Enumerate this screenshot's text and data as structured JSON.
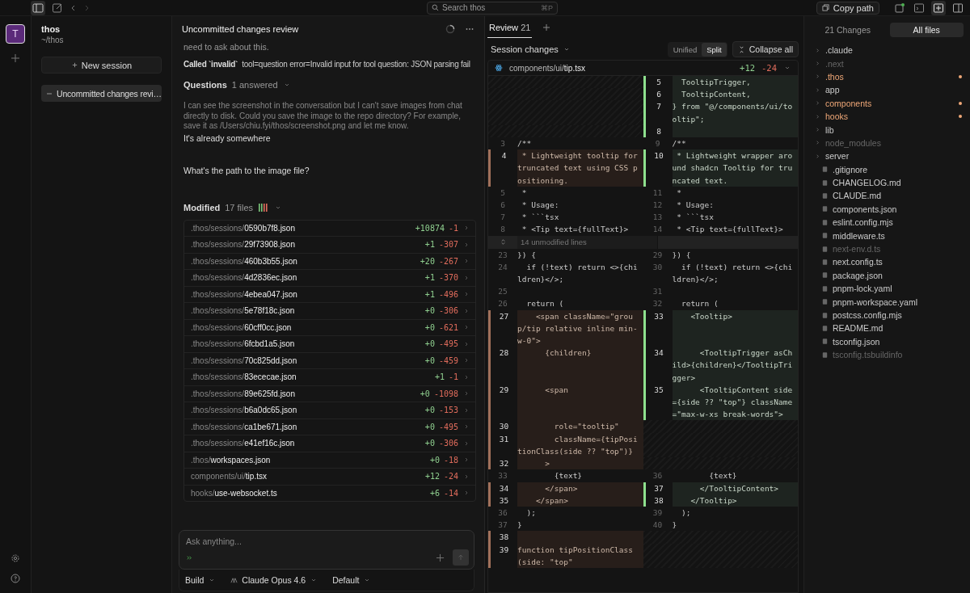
{
  "topbar": {
    "search": {
      "placeholder": "Search thos",
      "shortcut": "⌘P"
    },
    "copy_path": "Copy path"
  },
  "rail": {
    "avatar": "T"
  },
  "sidebar": {
    "project": "thos",
    "path": "~/thos",
    "new_session": "New session",
    "sessions": [
      {
        "title": "Uncommitted changes revi…",
        "selected": true
      }
    ]
  },
  "chat": {
    "title": "Uncommitted changes review",
    "cut_text": "need to ask about this.",
    "tool_call": {
      "label": "Called `invalid`",
      "detail": "tool=question  error=Invalid input for tool question: JSON parsing fail"
    },
    "questions": {
      "label": "Questions",
      "status": "1 answered"
    },
    "assistant_text": "I can see the screenshot in the conversation but I can't save images from chat directly to disk. Could you save the image to the repo directory? For example, save it as /Users/chiu.fyi/thos/screenshot.png and let me know.",
    "answer": "It's already somewhere",
    "question": "What's the path to the image file?",
    "modified": {
      "label": "Modified",
      "count": "17 files"
    },
    "files": [
      {
        "dir": ".thos/sessions/",
        "name": "0590b7f8.json",
        "added": "+10874",
        "removed": "-1"
      },
      {
        "dir": ".thos/sessions/",
        "name": "29f73908.json",
        "added": "+1",
        "removed": "-307"
      },
      {
        "dir": ".thos/sessions/",
        "name": "460b3b55.json",
        "added": "+20",
        "removed": "-267"
      },
      {
        "dir": ".thos/sessions/",
        "name": "4d2836ec.json",
        "added": "+1",
        "removed": "-370"
      },
      {
        "dir": ".thos/sessions/",
        "name": "4ebea047.json",
        "added": "+1",
        "removed": "-496"
      },
      {
        "dir": ".thos/sessions/",
        "name": "5e78f18c.json",
        "added": "+0",
        "removed": "-306"
      },
      {
        "dir": ".thos/sessions/",
        "name": "60cff0cc.json",
        "added": "+0",
        "removed": "-621"
      },
      {
        "dir": ".thos/sessions/",
        "name": "6fcbd1a5.json",
        "added": "+0",
        "removed": "-495"
      },
      {
        "dir": ".thos/sessions/",
        "name": "70c825dd.json",
        "added": "+0",
        "removed": "-459"
      },
      {
        "dir": ".thos/sessions/",
        "name": "83ececae.json",
        "added": "+1",
        "removed": "-1"
      },
      {
        "dir": ".thos/sessions/",
        "name": "89e625fd.json",
        "added": "+0",
        "removed": "-1098"
      },
      {
        "dir": ".thos/sessions/",
        "name": "b6a0dc65.json",
        "added": "+0",
        "removed": "-153"
      },
      {
        "dir": ".thos/sessions/",
        "name": "ca1be671.json",
        "added": "+0",
        "removed": "-495"
      },
      {
        "dir": ".thos/sessions/",
        "name": "e41ef16c.json",
        "added": "+0",
        "removed": "-306"
      },
      {
        "dir": ".thos/",
        "name": "workspaces.json",
        "added": "+0",
        "removed": "-18"
      },
      {
        "dir": "components/ui/",
        "name": "tip.tsx",
        "added": "+12",
        "removed": "-24"
      },
      {
        "dir": "hooks/",
        "name": "use-websocket.ts",
        "added": "+6",
        "removed": "-14"
      }
    ],
    "input": {
      "placeholder": "Ask anything..."
    },
    "footer": {
      "mode": "Build",
      "model": "Claude Opus 4.6",
      "variant": "Default"
    }
  },
  "review": {
    "tabs": [
      {
        "label": "Review",
        "count": "21",
        "selected": true
      }
    ],
    "section": "Session changes",
    "view_modes": [
      {
        "label": "Unified",
        "selected": false
      },
      {
        "label": "Split",
        "selected": true
      }
    ],
    "collapse_all": "Collapse all",
    "file": {
      "dir": "components/ui/",
      "name": "tip.tsx",
      "added": "+12",
      "removed": "-24"
    },
    "rows": [
      {
        "kind": "split",
        "left": {
          "kind": "empty"
        },
        "right": {
          "kind": "added",
          "num": "5",
          "code": "  TooltipTrigger,"
        }
      },
      {
        "kind": "split",
        "left": {
          "kind": "empty"
        },
        "right": {
          "kind": "added",
          "num": "6",
          "code": "  TooltipContent,"
        }
      },
      {
        "kind": "split",
        "left": {
          "kind": "empty"
        },
        "right": {
          "kind": "added",
          "num": "7",
          "code": "} from \"@/components/ui/tooltip\";"
        }
      },
      {
        "kind": "split",
        "left": {
          "kind": "empty"
        },
        "right": {
          "kind": "added",
          "num": "8"
        }
      },
      {
        "kind": "split",
        "left": {
          "kind": "context",
          "num": "3",
          "code": "/**"
        },
        "right": {
          "kind": "context",
          "num": "9",
          "code": "/**"
        }
      },
      {
        "kind": "split",
        "left": {
          "kind": "removed",
          "num": "4",
          "code": " * Lightweight tooltip for truncated text using CSS positioning."
        },
        "right": {
          "kind": "added",
          "num": "10",
          "code": " * Lightweight wrapper around shadcn Tooltip for truncated text."
        }
      },
      {
        "kind": "split",
        "left": {
          "kind": "context",
          "num": "5",
          "code": " *"
        },
        "right": {
          "kind": "context",
          "num": "11",
          "code": " *"
        }
      },
      {
        "kind": "split",
        "left": {
          "kind": "context",
          "num": "6",
          "code": " * Usage:"
        },
        "right": {
          "kind": "context",
          "num": "12",
          "code": " * Usage:"
        }
      },
      {
        "kind": "split",
        "left": {
          "kind": "context",
          "num": "7",
          "code": " * ```tsx"
        },
        "right": {
          "kind": "context",
          "num": "13",
          "code": " * ```tsx"
        }
      },
      {
        "kind": "split",
        "left": {
          "kind": "context",
          "num": "8",
          "code": " * <Tip text={fullText}>"
        },
        "right": {
          "kind": "context",
          "num": "14",
          "code": " * <Tip text={fullText}>"
        }
      },
      {
        "kind": "collapsed",
        "text": "14 unmodified lines"
      },
      {
        "kind": "split",
        "left": {
          "kind": "context",
          "num": "23",
          "code": "}) {"
        },
        "right": {
          "kind": "context",
          "num": "29",
          "code": "}) {"
        }
      },
      {
        "kind": "split",
        "left": {
          "kind": "context",
          "num": "24",
          "code": "  if (!text) return <>{children}</>;"
        },
        "right": {
          "kind": "context",
          "num": "30",
          "code": "  if (!text) return <>{children}</>;"
        }
      },
      {
        "kind": "split",
        "left": {
          "kind": "context",
          "num": "25"
        },
        "right": {
          "kind": "context",
          "num": "31"
        }
      },
      {
        "kind": "split",
        "left": {
          "kind": "context",
          "num": "26",
          "code": "  return ("
        },
        "right": {
          "kind": "context",
          "num": "32",
          "code": "  return ("
        }
      },
      {
        "kind": "split",
        "left": {
          "kind": "removed",
          "num": "27",
          "code": "    <span className=\"group/tip relative inline min-w-0\">"
        },
        "right": {
          "kind": "added",
          "num": "33",
          "code": "    <Tooltip>"
        }
      },
      {
        "kind": "split",
        "left": {
          "kind": "removed",
          "num": "28",
          "code": "      {children}"
        },
        "right": {
          "kind": "added",
          "num": "34",
          "code": "      <TooltipTrigger asChild>{children}</TooltipTrigger>"
        }
      },
      {
        "kind": "split",
        "left": {
          "kind": "removed",
          "num": "29",
          "code": "      <span"
        },
        "right": {
          "kind": "added",
          "num": "35",
          "code": "      <TooltipContent side={side ?? \"top\"} className=\"max-w-xs break-words\">"
        }
      },
      {
        "kind": "split",
        "left": {
          "kind": "removed",
          "num": "30",
          "code": "        role=\"tooltip\""
        },
        "right": {
          "kind": "empty"
        }
      },
      {
        "kind": "split",
        "left": {
          "kind": "removed",
          "num": "31",
          "code": "        className={tipPositionClass(side ?? \"top\")}"
        },
        "right": {
          "kind": "empty"
        }
      },
      {
        "kind": "split",
        "left": {
          "kind": "removed",
          "num": "32",
          "code": "      >"
        },
        "right": {
          "kind": "empty"
        }
      },
      {
        "kind": "split",
        "left": {
          "kind": "context",
          "num": "33",
          "code": "        {text}"
        },
        "right": {
          "kind": "context",
          "num": "36",
          "code": "        {text}"
        }
      },
      {
        "kind": "split",
        "left": {
          "kind": "removed",
          "num": "34",
          "code": "      </span>"
        },
        "right": {
          "kind": "added",
          "num": "37",
          "code": "      </TooltipContent>"
        }
      },
      {
        "kind": "split",
        "left": {
          "kind": "removed",
          "num": "35",
          "code": "    </span>"
        },
        "right": {
          "kind": "added",
          "num": "38",
          "code": "    </Tooltip>"
        }
      },
      {
        "kind": "split",
        "left": {
          "kind": "context",
          "num": "36",
          "code": "  );"
        },
        "right": {
          "kind": "context",
          "num": "39",
          "code": "  );"
        }
      },
      {
        "kind": "split",
        "left": {
          "kind": "context",
          "num": "37",
          "code": "}"
        },
        "right": {
          "kind": "context",
          "num": "40",
          "code": "}"
        }
      },
      {
        "kind": "split",
        "left": {
          "kind": "removed",
          "num": "38"
        },
        "right": {
          "kind": "empty"
        }
      },
      {
        "kind": "split",
        "left": {
          "kind": "removed",
          "num": "39",
          "code": "function tipPositionClass(side: \"top\""
        },
        "right": {
          "kind": "empty"
        }
      }
    ]
  },
  "files_panel": {
    "tabs": [
      {
        "label": "21 Changes",
        "selected": false
      },
      {
        "label": "All files",
        "selected": true
      }
    ],
    "tree": [
      {
        "kind": "folder",
        "name": ".claude",
        "modified": false,
        "dimmed": false
      },
      {
        "kind": "folder",
        "name": ".next",
        "modified": false,
        "dimmed": true
      },
      {
        "kind": "folder",
        "name": ".thos",
        "modified": true,
        "dimmed": false
      },
      {
        "kind": "folder",
        "name": "app",
        "modified": false,
        "dimmed": false
      },
      {
        "kind": "folder",
        "name": "components",
        "modified": true,
        "dimmed": false
      },
      {
        "kind": "folder",
        "name": "hooks",
        "modified": true,
        "dimmed": false
      },
      {
        "kind": "folder",
        "name": "lib",
        "modified": false,
        "dimmed": false
      },
      {
        "kind": "folder",
        "name": "node_modules",
        "modified": false,
        "dimmed": true
      },
      {
        "kind": "folder",
        "name": "server",
        "modified": false,
        "dimmed": false
      },
      {
        "kind": "file",
        "name": ".gitignore",
        "modified": false,
        "dimmed": false
      },
      {
        "kind": "file",
        "name": "CHANGELOG.md",
        "modified": false,
        "dimmed": false
      },
      {
        "kind": "file",
        "name": "CLAUDE.md",
        "modified": false,
        "dimmed": false
      },
      {
        "kind": "file",
        "name": "components.json",
        "modified": false,
        "dimmed": false
      },
      {
        "kind": "file",
        "name": "eslint.config.mjs",
        "modified": false,
        "dimmed": false
      },
      {
        "kind": "file",
        "name": "middleware.ts",
        "modified": false,
        "dimmed": false
      },
      {
        "kind": "file",
        "name": "next-env.d.ts",
        "modified": false,
        "dimmed": true
      },
      {
        "kind": "file",
        "name": "next.config.ts",
        "modified": false,
        "dimmed": false
      },
      {
        "kind": "file",
        "name": "package.json",
        "modified": false,
        "dimmed": false
      },
      {
        "kind": "file",
        "name": "pnpm-lock.yaml",
        "modified": false,
        "dimmed": false
      },
      {
        "kind": "file",
        "name": "pnpm-workspace.yaml",
        "modified": false,
        "dimmed": false
      },
      {
        "kind": "file",
        "name": "postcss.config.mjs",
        "modified": false,
        "dimmed": false
      },
      {
        "kind": "file",
        "name": "README.md",
        "modified": false,
        "dimmed": false
      },
      {
        "kind": "file",
        "name": "tsconfig.json",
        "modified": false,
        "dimmed": false
      },
      {
        "kind": "file",
        "name": "tsconfig.tsbuildinfo",
        "modified": false,
        "dimmed": true
      }
    ]
  }
}
